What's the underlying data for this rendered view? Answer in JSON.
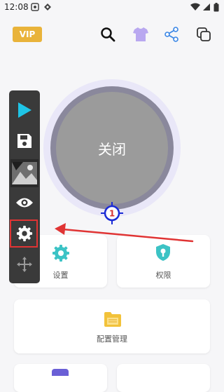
{
  "status": {
    "time": "12:08"
  },
  "header": {
    "vip_label": "VIP"
  },
  "main": {
    "close_button_label": "关闭",
    "crosshair_number": "1"
  },
  "cards": [
    {
      "label": "设置"
    },
    {
      "label": "权限"
    },
    {
      "label": "配置管理"
    }
  ],
  "colors": {
    "accent_teal": "#3cc3c5",
    "vip_gold": "#e9b33a",
    "annotation_red": "#e03434",
    "toolbar_bg": "#3a3a3a"
  },
  "icons": [
    "play-icon",
    "save-icon",
    "thumbnail-image",
    "eye-icon",
    "gear-icon",
    "move-icon",
    "search-icon",
    "shirt-icon",
    "share-icon",
    "copy-icon"
  ]
}
